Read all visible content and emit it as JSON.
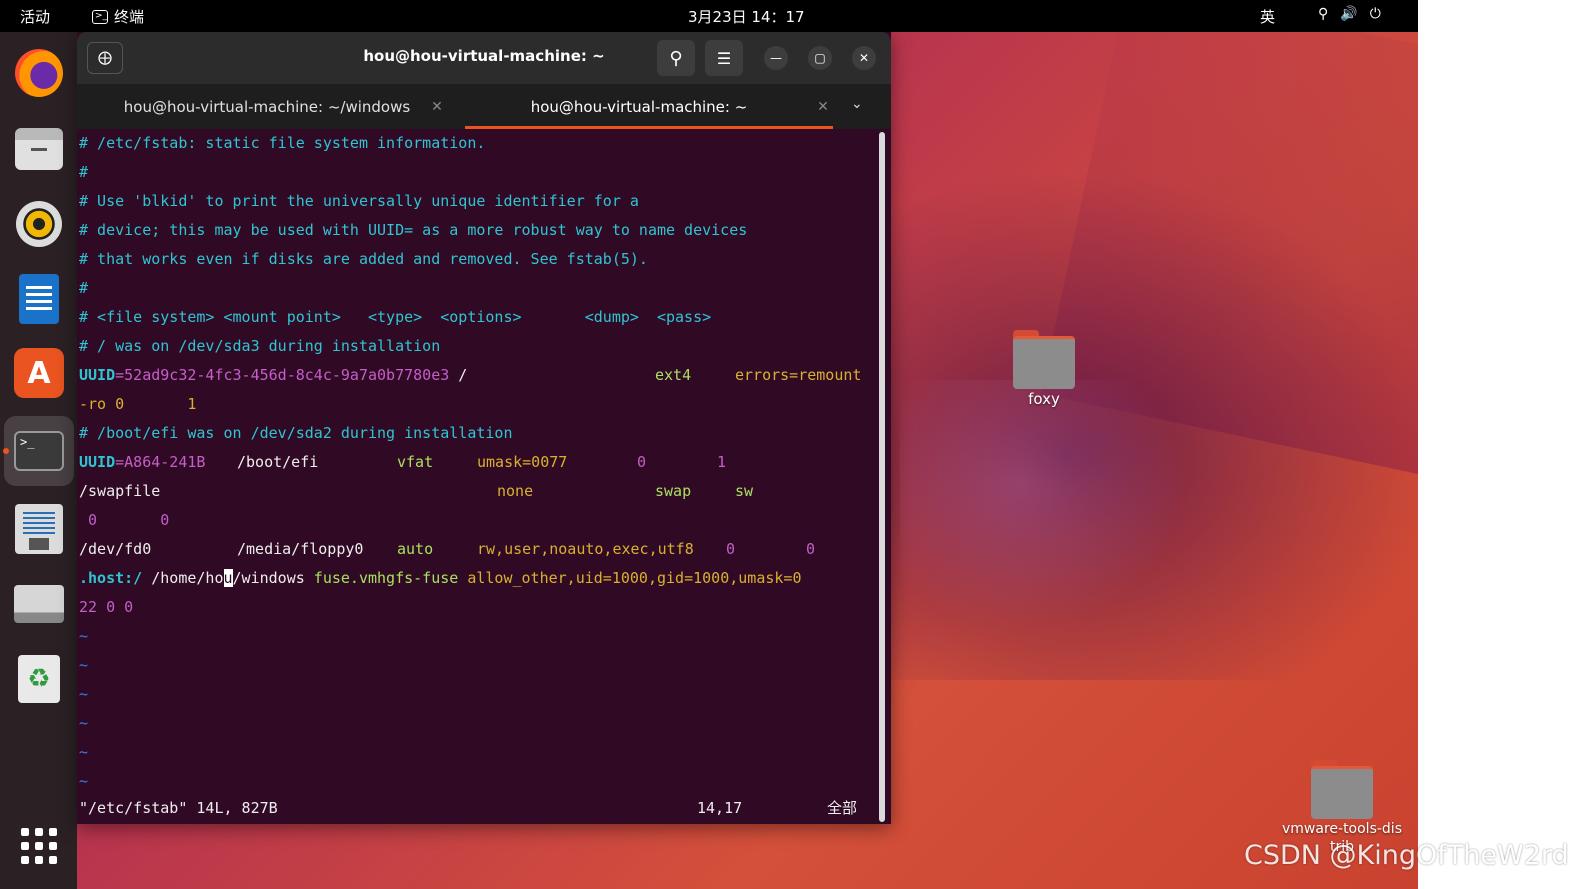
{
  "topbar": {
    "activities": "活动",
    "app_name": "终端",
    "clock": "3月23日  14：17",
    "ime": "英",
    "tray_icons": [
      "network-icon",
      "volume-icon",
      "power-icon"
    ]
  },
  "dock": {
    "items": [
      "firefox",
      "files",
      "rhythmbox",
      "libreoffice-writer",
      "ubuntu-software",
      "terminal",
      "text-editor",
      "disk",
      "trash",
      "show-applications"
    ],
    "active": "terminal"
  },
  "window": {
    "title": "hou@hou-virtual-machine: ~",
    "tabs": [
      {
        "label": "hou@hou-virtual-machine: ~/windows",
        "active": false
      },
      {
        "label": "hou@hou-virtual-machine: ~",
        "active": true
      }
    ]
  },
  "terminal": {
    "lines": [
      "# /etc/fstab: static file system information.",
      "#",
      "# Use 'blkid' to print the universally unique identifier for a",
      "# device; this may be used with UUID= as a more robust way to name devices",
      "# that works even if disks are added and removed. See fstab(5).",
      "#",
      "# <file system> <mount point>   <type>  <options>       <dump>  <pass>",
      "# / was on /dev/sda3 during installation"
    ],
    "uuid1": {
      "key": "UUID",
      "value": "=52ad9c32-4fc3-456d-8c4c-9a7a0b7780e3",
      "mount": " /",
      "type": "ext4",
      "opts": "errors=remount",
      "cont": "-ro 0       1"
    },
    "boot_comment": "# /boot/efi was on /dev/sda2 during installation",
    "uuid2": {
      "key": "UUID",
      "value": "=A864-241B",
      "mount": "/boot/efi",
      "type": "vfat",
      "opts": "umask=0077",
      "dump": "0",
      "pass": "1"
    },
    "swap": {
      "fs": "/swapfile",
      "mount": "none",
      "type": "swap",
      "opts": "sw",
      "cont": " 0       0"
    },
    "floppy": {
      "fs": "/dev/fd0",
      "mount": "/media/floppy0",
      "type": "auto",
      "opts": "rw,user,noauto,exec,utf8",
      "dump": "0",
      "pass": "0"
    },
    "vmhgfs": {
      "fs_a": ".host:/",
      "mount_a": " /home/ho",
      "cursor_char": "u",
      "mount_b": "/windows",
      "type": " fuse.vmhgfs-fuse ",
      "opts": "allow_other,uid=1000,gid=1000,umask=0",
      "cont": "22 0 0"
    },
    "tilde_lines": [
      "~",
      "~",
      "~",
      "~",
      "~",
      "~"
    ],
    "status": {
      "file": "\"/etc/fstab\" 14L, 827B",
      "pos": "14,17",
      "scope": "全部"
    }
  },
  "desktop": {
    "folders": [
      {
        "label": "foxy"
      },
      {
        "label": "vmware-tools-distrib"
      }
    ]
  },
  "watermark": "CSDN @KingOfTheW2rd",
  "colors": {
    "terminal_bg": "#300a24",
    "accent": "#e95420",
    "comment": "#2ec5d3",
    "value": "#c45ec8",
    "option": "#d8b030"
  }
}
